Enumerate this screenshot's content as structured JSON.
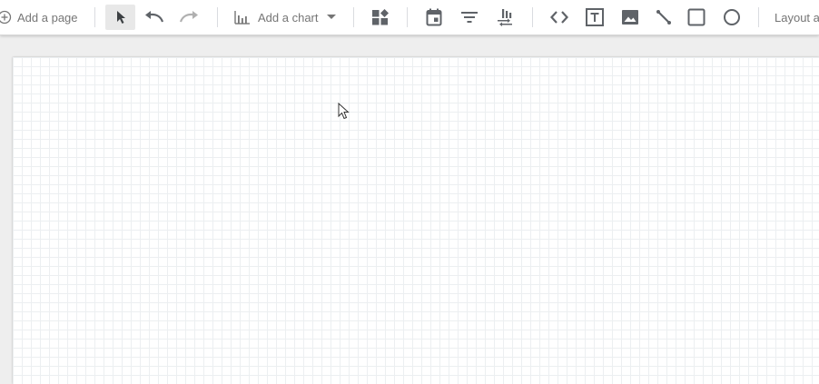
{
  "toolbar": {
    "add_page_label": "Add a page",
    "add_chart_label": "Add a chart",
    "layout_label": "Layout a",
    "icons": [
      "add-circle-icon",
      "select-pointer-icon",
      "undo-icon",
      "redo-icon",
      "bar-chart-icon",
      "dropdown-arrow-icon",
      "community-visualizations-icon",
      "date-range-icon",
      "filter-control-icon",
      "data-control-icon",
      "embed-code-icon",
      "text-icon",
      "image-icon",
      "line-icon",
      "rectangle-icon",
      "circle-icon"
    ]
  },
  "colors": {
    "toolbar_bg": "#ffffff",
    "icon": "#5f6368",
    "canvas_bg": "#eeeeee",
    "page_bg": "#ffffff",
    "grid": "#eceff1"
  }
}
